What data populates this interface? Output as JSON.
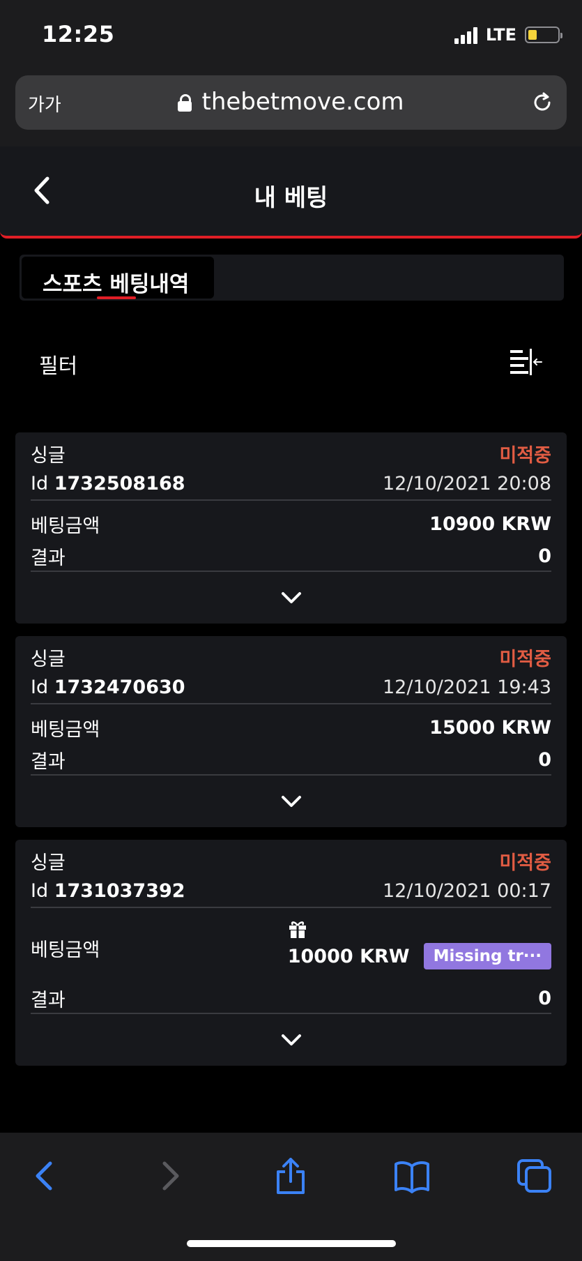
{
  "status_bar": {
    "time": "12:25",
    "network": "LTE"
  },
  "address_bar": {
    "text_size": "가가",
    "url": "thebetmove.com"
  },
  "header": {
    "title": "내 베팅"
  },
  "tabs": [
    {
      "label": "스포츠 베팅내역",
      "active": true
    }
  ],
  "filter": {
    "label": "필터"
  },
  "labels": {
    "id_prefix": "Id",
    "stake": "베팅금액",
    "result": "결과"
  },
  "bets": [
    {
      "type": "싱글",
      "status": "미적중",
      "id": "1732508168",
      "date": "12/10/2021 20:08",
      "stake": "10900 KRW",
      "result": "0"
    },
    {
      "type": "싱글",
      "status": "미적중",
      "id": "1732470630",
      "date": "12/10/2021 19:43",
      "stake": "15000 KRW",
      "result": "0"
    },
    {
      "type": "싱글",
      "status": "미적중",
      "id": "1731037392",
      "date": "12/10/2021 00:17",
      "stake": "10000 KRW",
      "result": "0",
      "badge": "Missing tr···"
    }
  ],
  "colors": {
    "accent_red": "#e01e26",
    "status_lost": "#e15c43",
    "badge_purple": "#9177e0",
    "safari_blue": "#3b82f6"
  },
  "toolbar_icons": [
    "back-icon",
    "forward-icon",
    "share-icon",
    "bookmarks-icon",
    "tabs-icon"
  ]
}
